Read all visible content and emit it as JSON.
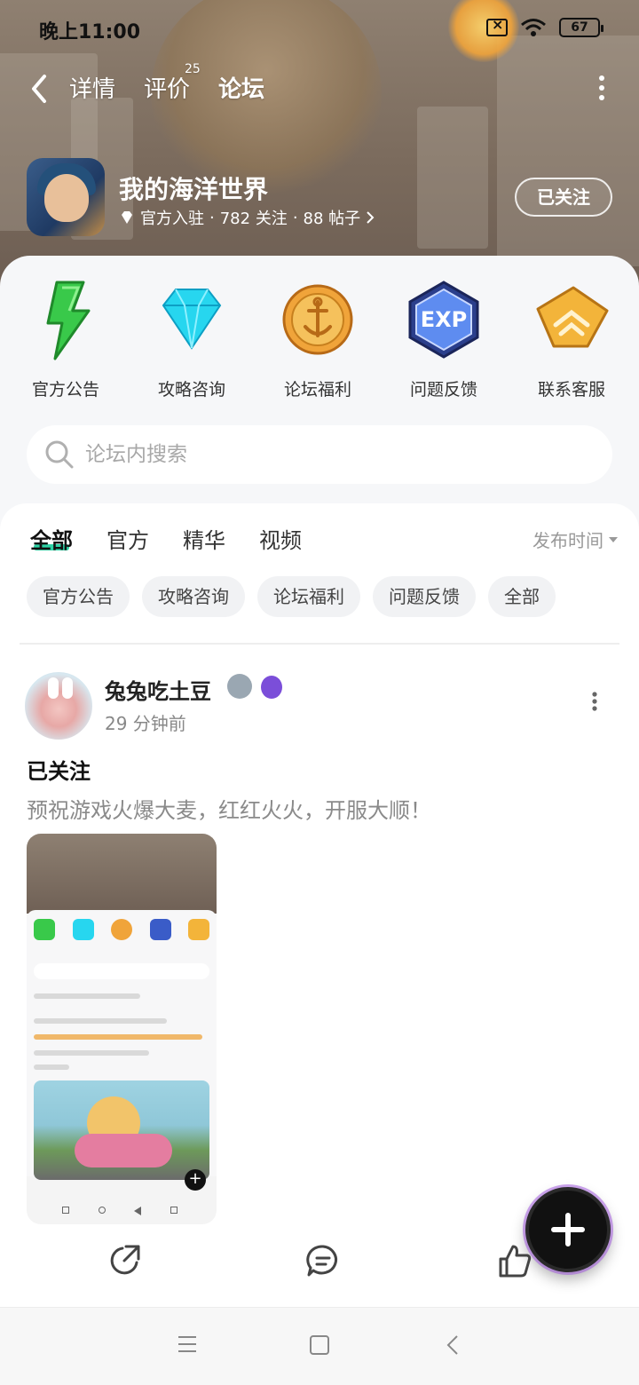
{
  "status_bar": {
    "time": "晚上11:00",
    "battery": "67"
  },
  "nav": {
    "tabs": [
      {
        "label": "详情"
      },
      {
        "label": "评价",
        "badge": "25"
      },
      {
        "label": "论坛"
      }
    ],
    "active_tab": "论坛"
  },
  "forum": {
    "title": "我的海洋世界",
    "meta_prefix": "官方入驻",
    "followers": "782 关注",
    "posts": "88 帖子",
    "follow_label": "已关注"
  },
  "categories": [
    {
      "label": "官方公告",
      "icon": "lightning-icon"
    },
    {
      "label": "攻略咨询",
      "icon": "diamond-icon"
    },
    {
      "label": "论坛福利",
      "icon": "coin-icon"
    },
    {
      "label": "问题反馈",
      "icon": "exp-icon"
    },
    {
      "label": "联系客服",
      "icon": "rank-icon"
    }
  ],
  "search": {
    "placeholder": "论坛内搜索"
  },
  "feed": {
    "tabs": [
      "全部",
      "官方",
      "精华",
      "视频"
    ],
    "active_tab": "全部",
    "sort_label": "发布时间",
    "chips": [
      "官方公告",
      "攻略咨询",
      "论坛福利",
      "问题反馈",
      "全部"
    ]
  },
  "post": {
    "username": "兔兔吃土豆",
    "time": "29 分钟前",
    "title": "已关注",
    "body": "预祝游戏火爆大麦，红红火火，开服大顺！"
  },
  "colors": {
    "accent": "#2ed3a6",
    "fab": "#111111"
  }
}
